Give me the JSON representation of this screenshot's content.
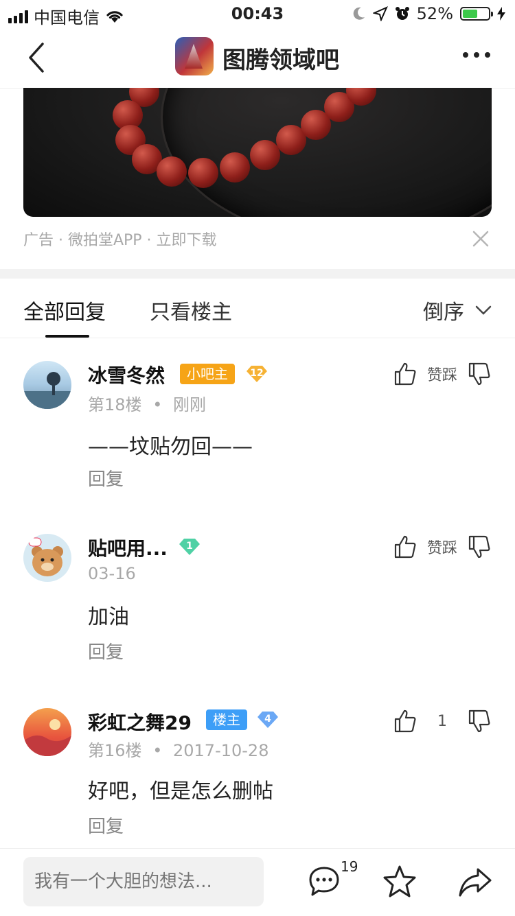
{
  "status_bar": {
    "carrier": "中国电信",
    "time": "00:43",
    "battery": "52%"
  },
  "nav": {
    "title": "图腾领域吧"
  },
  "ad": {
    "info": "广告 · 微拍堂APP · 立即下载"
  },
  "tabs": {
    "all_replies": "全部回复",
    "only_op": "只看楼主",
    "sort": "倒序"
  },
  "replies": [
    {
      "username": "冰雪冬然",
      "badge": "小吧主",
      "level": "12",
      "floor": "第18楼",
      "time": "刚刚",
      "content": "——坟贴勿回——",
      "reply_label": "回复",
      "vote_label": "赞踩"
    },
    {
      "username": "贴吧用...",
      "level": "1",
      "time": "03-16",
      "content": "加油",
      "reply_label": "回复",
      "vote_label": "赞踩"
    },
    {
      "username": "彩虹之舞29",
      "badge": "楼主",
      "level": "4",
      "floor": "第16楼",
      "time": "2017-10-28",
      "content": "好吧，但是怎么删帖",
      "reply_label": "回复",
      "vote_label": "1"
    }
  ],
  "bottom_bar": {
    "input_placeholder": "我有一个大胆的想法...",
    "comment_count": "19"
  },
  "colors": {
    "small_owner_badge": "#f6a417",
    "op_badge": "#3d9ef7",
    "level_orange": "#f6b234",
    "level_green": "#4fd1a5",
    "level_blue": "#6ba8f5"
  }
}
